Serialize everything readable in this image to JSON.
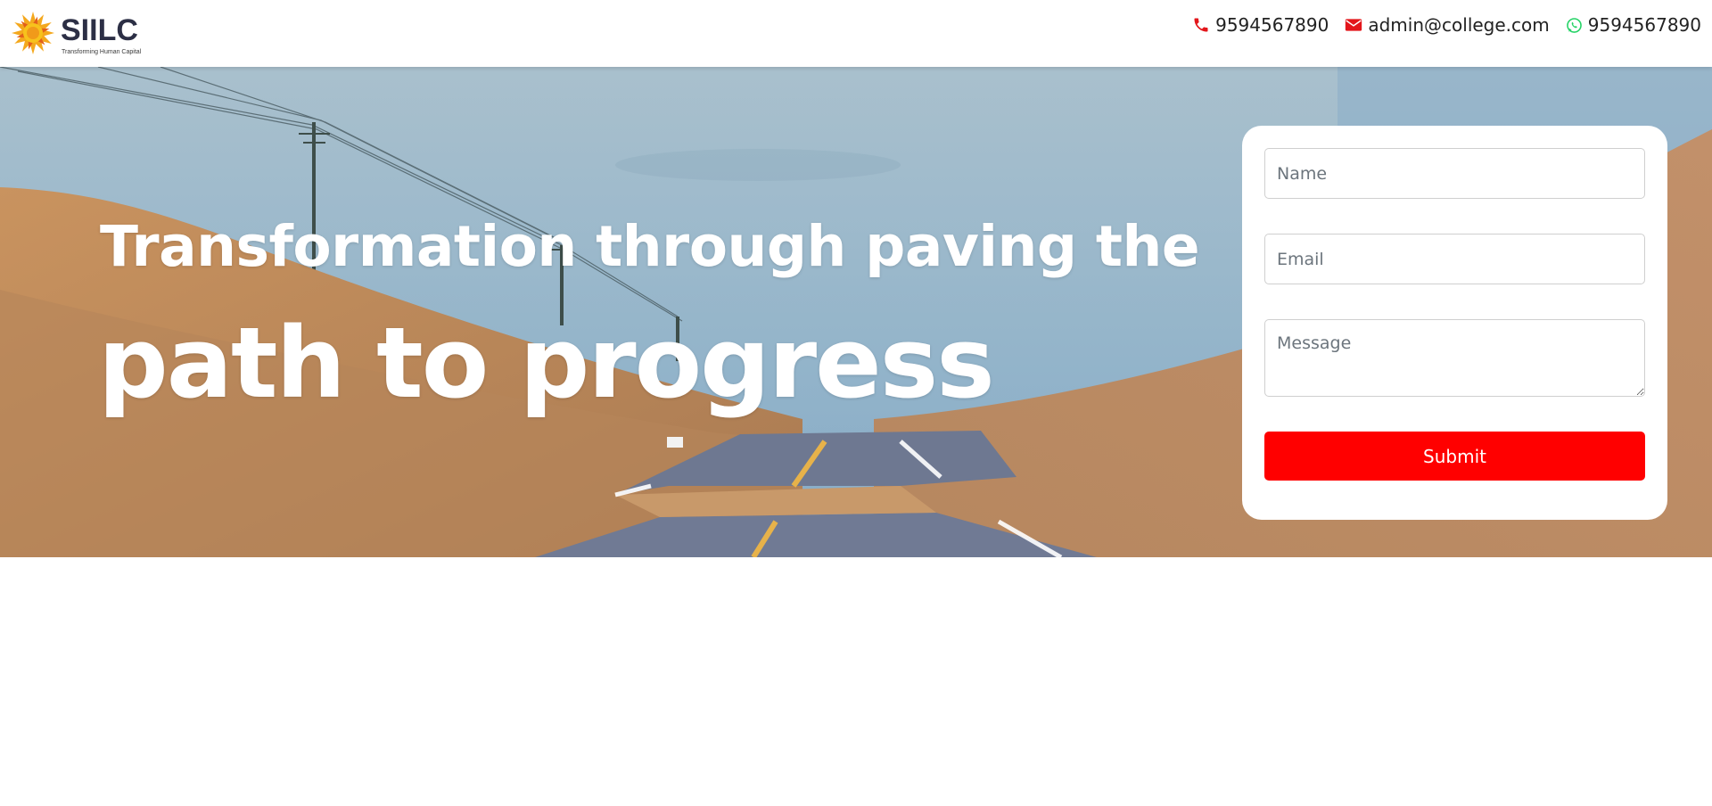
{
  "header": {
    "logo": {
      "name": "SIILC",
      "tagline": "Transforming Human Capital"
    },
    "contacts": [
      {
        "icon": "phone-icon",
        "text": "9594567890",
        "color": "#e3161b"
      },
      {
        "icon": "envelope-icon",
        "text": "admin@college.com",
        "color": "#e3161b"
      },
      {
        "icon": "whatsapp-icon",
        "text": "9594567890",
        "color": "#25d366"
      }
    ]
  },
  "hero": {
    "headline_line1": "Transformation through paving the",
    "headline_line2": "path to progress"
  },
  "form": {
    "name_placeholder": "Name",
    "email_placeholder": "Email",
    "message_placeholder": "Message",
    "submit_label": "Submit",
    "submit_color": "#ff0000"
  }
}
